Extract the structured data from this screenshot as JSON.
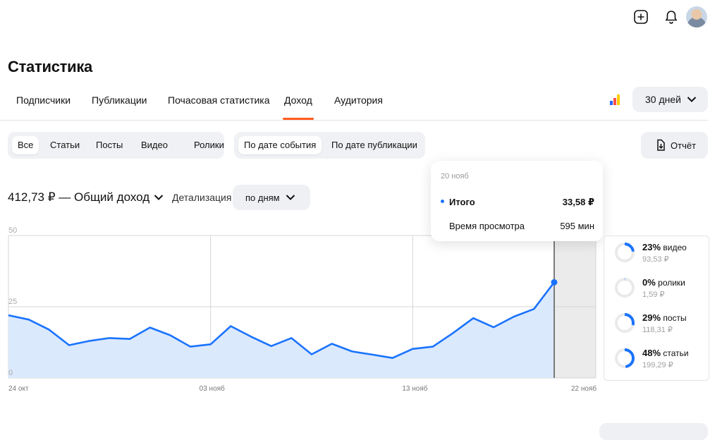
{
  "header": {
    "title": "Статистика"
  },
  "tabs": [
    {
      "label": "Подписчики",
      "active": false
    },
    {
      "label": "Публикации",
      "active": false
    },
    {
      "label": "Почасовая статистика",
      "active": false
    },
    {
      "label": "Доход",
      "active": true
    },
    {
      "label": "Аудитория",
      "active": false
    }
  ],
  "period": {
    "label": "30 дней"
  },
  "content_filter": [
    "Все",
    "Статьи",
    "Посты",
    "Видео",
    "Ролики"
  ],
  "content_filter_selected": "Все",
  "date_filter": [
    "По дате события",
    "По дате публикации"
  ],
  "date_filter_selected": "По дате события",
  "report_button": {
    "label": "Отчёт"
  },
  "total": {
    "text": "412,73 ₽ — Общий доход"
  },
  "detail": {
    "label": "Детализация",
    "value": "по дням"
  },
  "tooltip": {
    "date": "20 нояб",
    "total_label": "Итого",
    "total_value": "33,58 ₽",
    "watch_label": "Время просмотра",
    "watch_value": "595 мин"
  },
  "colors": {
    "accent": "#1a73ff",
    "tab_underline": "#ff5a1f",
    "fill": "#dbe9fd"
  },
  "chart_data": {
    "type": "area",
    "x_ticks": [
      "24 окт",
      "03 нояб",
      "13 нояб",
      "22 нояб"
    ],
    "y_ticks": [
      "50",
      "25",
      "0"
    ],
    "ylim": [
      0,
      50
    ],
    "grid": true,
    "highlight_index": 27,
    "values": [
      22,
      20.5,
      17,
      11.5,
      13,
      14,
      13.7,
      17.7,
      15,
      11,
      11.8,
      18.2,
      14.5,
      11.2,
      14,
      8.3,
      12,
      9.3,
      8.2,
      7,
      10.2,
      11,
      15.8,
      21,
      17.8,
      21.5,
      24.2,
      33.58
    ]
  },
  "breakdown": [
    {
      "percent": "23%",
      "name": "видео",
      "value": "93,53 ₽",
      "share": 0.23
    },
    {
      "percent": "0%",
      "name": "ролики",
      "value": "1,59 ₽",
      "share": 0.005
    },
    {
      "percent": "29%",
      "name": "посты",
      "value": "118,31 ₽",
      "share": 0.29
    },
    {
      "percent": "48%",
      "name": "статьи",
      "value": "199,29 ₽",
      "share": 0.48
    }
  ]
}
